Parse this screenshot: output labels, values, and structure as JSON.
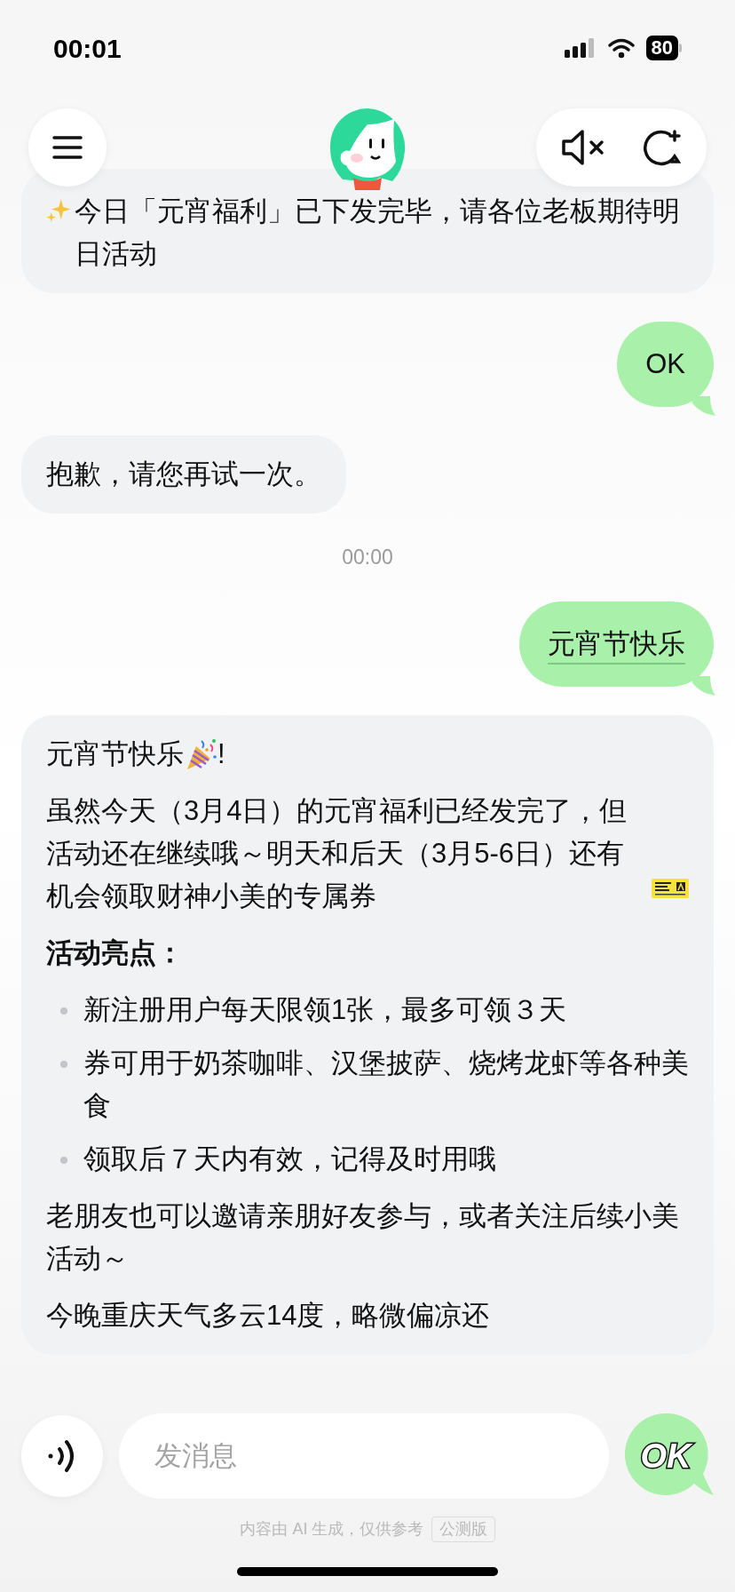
{
  "status_bar": {
    "time": "00:01",
    "battery": "80"
  },
  "messages": [
    {
      "kind": "bot",
      "paragraphs": [
        {
          "kind": "sparkle_text",
          "text": "今日「元宵福利」已下发完毕，请各位老板期待明日活动"
        }
      ]
    },
    {
      "kind": "user",
      "text": "OK",
      "underlined": false
    },
    {
      "kind": "bot",
      "paragraphs": [
        {
          "kind": "text",
          "text": "抱歉，请您再试一次。"
        }
      ]
    },
    {
      "kind": "time",
      "text": "00:00"
    },
    {
      "kind": "user",
      "text": "元宵节快乐",
      "underlined": true
    },
    {
      "kind": "bot",
      "paragraphs": [
        {
          "kind": "party_title",
          "text": "元宵节快乐",
          "suffix": "!"
        },
        {
          "kind": "ticket_text",
          "text": "虽然今天（3月4日）的元宵福利已经发完了，但活动还在继续哦～明天和后天（3月5-6日）还有机会领取财神小美的专属券"
        },
        {
          "kind": "heading",
          "text": "活动亮点："
        },
        {
          "kind": "bullets",
          "items": [
            "新注册用户每天限领1张，最多可领３天",
            "券可用于奶茶咖啡、汉堡披萨、烧烤龙虾等各种美食",
            "领取后７天内有效，记得及时用哦"
          ]
        },
        {
          "kind": "text",
          "text": "老朋友也可以邀请亲朋好友参与，或者关注后续小美活动～"
        },
        {
          "kind": "text",
          "text": "今晚重庆天气多云14度，略微偏凉还"
        }
      ]
    }
  ],
  "input": {
    "placeholder": "发消息",
    "logo": "OK"
  },
  "footer": {
    "disclaimer": "内容由 AI 生成，仅供参考",
    "badge": "公测版"
  }
}
